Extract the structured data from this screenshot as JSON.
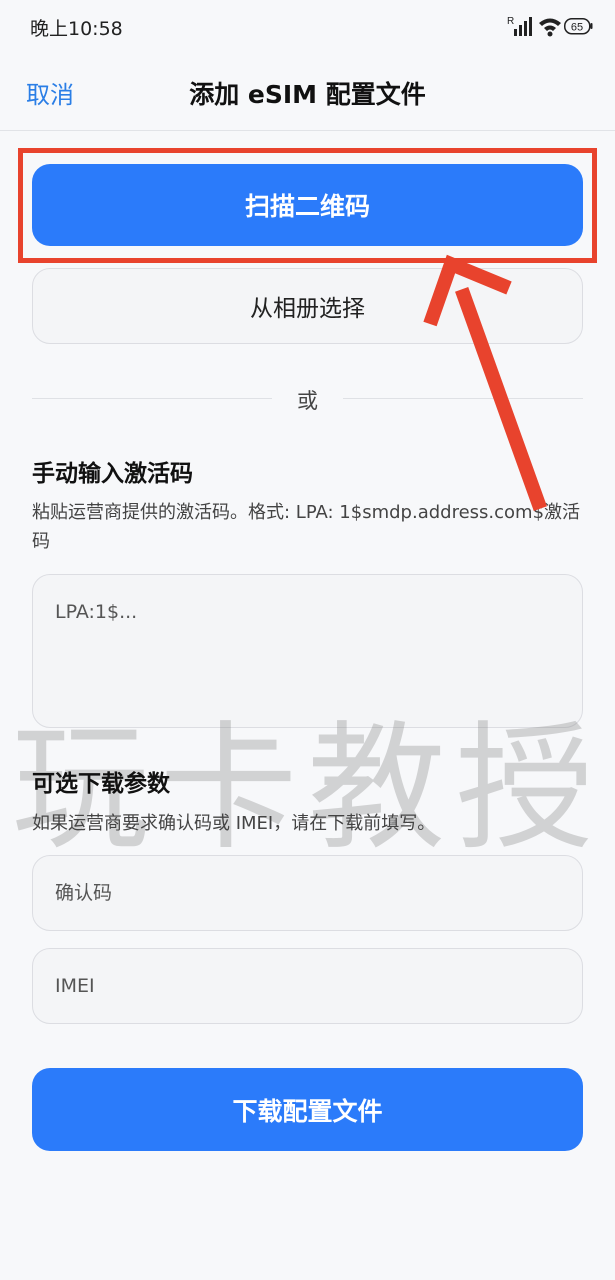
{
  "status_bar": {
    "time": "晚上10:58",
    "signal_badge": "R",
    "battery": "65"
  },
  "nav": {
    "cancel_label": "取消",
    "title": "添加 eSIM 配置文件"
  },
  "scan_button_label": "扫描二维码",
  "album_button_label": "从相册选择",
  "divider_text": "或",
  "manual": {
    "title": "手动输入激活码",
    "description": "粘贴运营商提供的激活码。格式: LPA: 1$smdp.address.com$激活码",
    "placeholder": "LPA:1$..."
  },
  "optional": {
    "title": "可选下载参数",
    "description": "如果运营商要求确认码或 IMEI，请在下载前填写。",
    "confirm_placeholder": "确认码",
    "imei_placeholder": "IMEI"
  },
  "download_button_label": "下载配置文件",
  "watermark_text": "玩卡教授",
  "colors": {
    "accent": "#2b7bfa",
    "link": "#2a7ee6",
    "annotation_red": "#e8432d"
  }
}
